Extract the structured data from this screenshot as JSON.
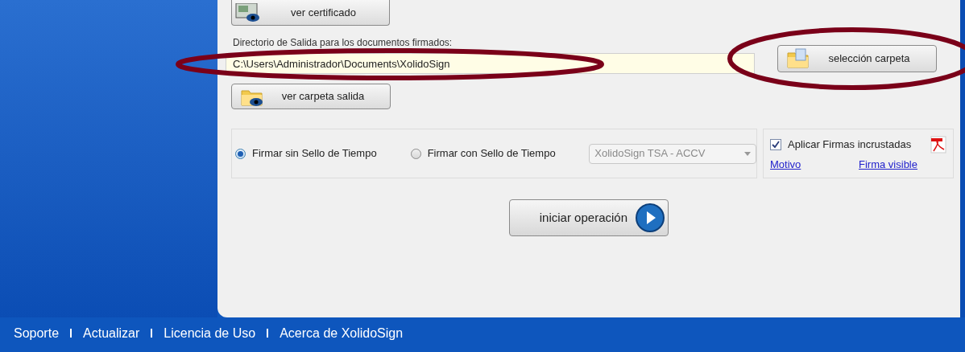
{
  "certificate_button": {
    "label": "ver certificado"
  },
  "output_directory": {
    "label": "Directorio de Salida para los documentos firmados:",
    "value": "C:\\Users\\Administrador\\Documents\\XolidoSign"
  },
  "select_folder_button": {
    "label": "selección carpeta"
  },
  "view_output_button": {
    "label": "ver carpeta salida"
  },
  "timestamp_options": [
    {
      "label": "Firmar sin Sello de Tiempo",
      "selected": true
    },
    {
      "label": "Firmar con Sello de Tiempo",
      "selected": false
    }
  ],
  "tsa_dropdown": {
    "value": "XolidoSign TSA - ACCV",
    "disabled": true
  },
  "embedded_signatures": {
    "label": "Aplicar Firmas incrustadas",
    "checked": true
  },
  "signature_links": [
    "Motivo",
    "Firma visible"
  ],
  "start_button": {
    "label": "iniciar operación"
  },
  "footer_links": [
    "Soporte",
    "Actualizar",
    "Licencia de Uso",
    "Acerca de XolidoSign"
  ]
}
